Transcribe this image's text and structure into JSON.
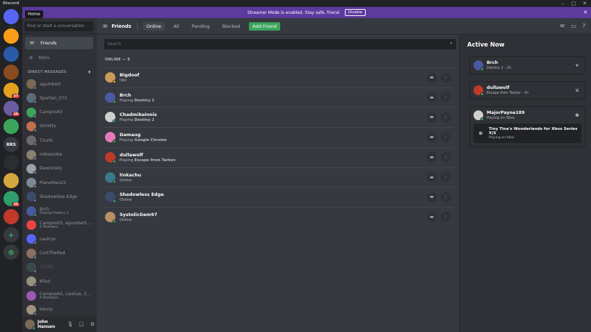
{
  "titlebar": {
    "app": "Discord",
    "min": "–",
    "max": "□",
    "close": "✕"
  },
  "home_tooltip": "Home",
  "servers": [
    {
      "label": "",
      "color": "#5865f2",
      "badge": ""
    },
    {
      "label": "",
      "color": "#f99e1a",
      "badge": ""
    },
    {
      "label": "",
      "color": "#2b5aa8",
      "badge": ""
    },
    {
      "label": "",
      "color": "#8a4b1e",
      "badge": ""
    },
    {
      "label": "",
      "color": "#e5a11f",
      "badge": "17"
    },
    {
      "label": "",
      "color": "#6b5ba0",
      "badge": "19"
    },
    {
      "label": "",
      "color": "#3ba55d",
      "badge": ""
    },
    {
      "label": "RRS",
      "color": "#36393f",
      "badge": ""
    },
    {
      "label": "",
      "color": "#2b2d31",
      "badge": ""
    },
    {
      "label": "",
      "color": "#d4a640",
      "badge": ""
    },
    {
      "label": "",
      "color": "#2f9e6a",
      "badge": "35"
    },
    {
      "label": "",
      "color": "#c0392b",
      "badge": ""
    },
    {
      "label": "+",
      "color": "#36393f",
      "badge": ""
    },
    {
      "label": "⊕",
      "color": "#36393f",
      "badge": ""
    }
  ],
  "search": {
    "placeholder": "Find or start a conversation"
  },
  "nav": {
    "friends": "Friends",
    "nitro": "Nitro"
  },
  "dm_header": {
    "label": "DIRECT MESSAGES",
    "plus": "+"
  },
  "dms": [
    {
      "name": "agumbert",
      "sub": "",
      "color": "#7a6a55",
      "status": "offline"
    },
    {
      "name": "Spartan_073",
      "sub": "",
      "color": "#5a6b7a",
      "status": "offline"
    },
    {
      "name": "Campos63",
      "sub": "",
      "color": "#3ba55d",
      "status": "offline"
    },
    {
      "name": "dsmitty",
      "sub": "",
      "color": "#c0704f",
      "status": "offline"
    },
    {
      "name": "Tzurki",
      "sub": "",
      "color": "#6b6b6b",
      "status": "offline"
    },
    {
      "name": "mikeszoke",
      "sub": "",
      "color": "#8a8070",
      "status": "offline"
    },
    {
      "name": "Dewlimely",
      "sub": "",
      "color": "#9aa0a8",
      "status": "offline"
    },
    {
      "name": "PianoMan23",
      "sub": "",
      "color": "#7d8a95",
      "status": "offline"
    },
    {
      "name": "Shadowless Edge",
      "sub": "",
      "color": "#3d4b6b",
      "status": "offline"
    },
    {
      "name": "Brch",
      "sub": "Playing Destiny 2",
      "color": "#4a5aa0",
      "status": "online"
    },
    {
      "name": "Campos63, agumbert, ...",
      "sub": "4 Members",
      "color": "#ed4245",
      "status": ""
    },
    {
      "name": "caulrye",
      "sub": "",
      "color": "#5865f2",
      "status": "offline"
    },
    {
      "name": "CurtTheRed",
      "sub": "",
      "color": "#8a7060",
      "status": "offline"
    },
    {
      "name": "S1EEK",
      "sub": "",
      "color": "#3a4a4a",
      "status": "offline",
      "dim": true
    },
    {
      "name": "KFed",
      "sub": "",
      "color": "#9a9080",
      "status": "offline"
    },
    {
      "name": "Campos63, caulrye, C...",
      "sub": "4 Members",
      "color": "#9b59b6",
      "status": ""
    },
    {
      "name": "kenny",
      "sub": "",
      "color": "#a09080",
      "status": "offline"
    }
  ],
  "user": {
    "name": "John Hansen",
    "mic": "🎙",
    "headset": "🎧",
    "settings": "⚙"
  },
  "banner": {
    "text": "Streamer Mode is enabled. Stay safe, friend.",
    "button": "Disable",
    "close": "✕"
  },
  "topbar": {
    "title": "Friends",
    "tabs": [
      "Online",
      "All",
      "Pending",
      "Blocked"
    ],
    "add_friend": "Add Friend"
  },
  "main_search": {
    "placeholder": "Search"
  },
  "online_header": "ONLINE — 8",
  "friends": [
    {
      "name": "Bigdoof",
      "pre": "Idle",
      "game": "",
      "color": "#c89a5a",
      "status": "idle"
    },
    {
      "name": "Brch",
      "pre": "Playing ",
      "game": "Destiny 2",
      "color": "#4a5aa0",
      "status": "online"
    },
    {
      "name": "Chadmikeinnis",
      "pre": "Playing ",
      "game": "Destiny 2",
      "color": "#cfcfcf",
      "status": "online"
    },
    {
      "name": "Damaug",
      "pre": "Playing ",
      "game": "Google Chrome",
      "color": "#e879b9",
      "status": "online"
    },
    {
      "name": "dullawolf",
      "pre": "Playing ",
      "game": "Escape from Tarkov",
      "color": "#c0392b",
      "status": "online"
    },
    {
      "name": "linkachu",
      "pre": "Online",
      "game": "",
      "color": "#3b7a8a",
      "status": "online"
    },
    {
      "name": "Shadowless Edge",
      "pre": "Online",
      "game": "",
      "color": "#3d4b6b",
      "status": "online"
    },
    {
      "name": "SystolicGem97",
      "pre": "Online",
      "game": "",
      "color": "#b89060",
      "status": "online"
    }
  ],
  "active_now": {
    "title": "Active Now",
    "cards": [
      {
        "name": "Brch",
        "sub": "Destiny 2 - 2h",
        "color": "#4a5aa0",
        "game_icon": "⋎"
      },
      {
        "name": "dullawolf",
        "sub": "Escape from Tarkov - 1h",
        "color": "#c0392b",
        "game_icon": "⚔"
      },
      {
        "name": "MajorPayne189",
        "sub": "Playing on Xbox",
        "color": "#cfcfcf",
        "game_icon": "⊗",
        "inner": {
          "title": "Tiny Tina's Wonderlands for Xbox Series X|S",
          "sub": "Playing on Xbox"
        }
      }
    ]
  },
  "colors": {
    "accent": "#5865f2",
    "banner": "#5c3a9e",
    "online": "#3ba55d",
    "idle": "#faa81a"
  }
}
